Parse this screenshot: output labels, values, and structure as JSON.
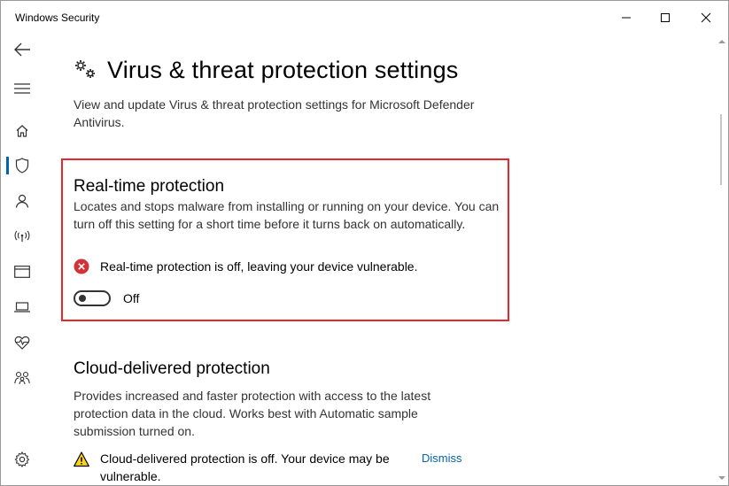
{
  "window": {
    "title": "Windows Security"
  },
  "sidebar": {
    "items": [
      {
        "name": "back",
        "icon": "back-arrow-icon"
      },
      {
        "name": "menu",
        "icon": "hamburger-menu-icon"
      },
      {
        "name": "home",
        "icon": "home-icon"
      },
      {
        "name": "virus-threat-protection",
        "icon": "shield-icon",
        "active": true
      },
      {
        "name": "account-protection",
        "icon": "person-icon"
      },
      {
        "name": "firewall-network",
        "icon": "wifi-antenna-icon"
      },
      {
        "name": "app-browser-control",
        "icon": "browser-window-icon"
      },
      {
        "name": "device-security",
        "icon": "laptop-icon"
      },
      {
        "name": "device-performance-health",
        "icon": "heart-pulse-icon"
      },
      {
        "name": "family-options",
        "icon": "family-icon"
      },
      {
        "name": "settings",
        "icon": "gear-icon"
      }
    ]
  },
  "page": {
    "title": "Virus & threat protection settings",
    "subtitle": "View and update Virus & threat protection settings for Microsoft Defender Antivirus."
  },
  "realtime": {
    "title": "Real-time protection",
    "description": "Locates and stops malware from installing or running on your device. You can turn off this setting for a short time before it turns back on automatically.",
    "status": "Real-time protection is off, leaving your device vulnerable.",
    "toggle_label": "Off",
    "toggle_on": false
  },
  "cloud": {
    "title": "Cloud-delivered protection",
    "description": "Provides increased and faster protection with access to the latest protection data in the cloud. Works best with Automatic sample submission turned on.",
    "warning": "Cloud-delivered protection is off. Your device may be vulnerable.",
    "dismiss_label": "Dismiss"
  },
  "colors": {
    "accent": "#0063b1",
    "highlight_border": "#e8262c",
    "error": "#d13438",
    "warning": "#fcd116"
  }
}
